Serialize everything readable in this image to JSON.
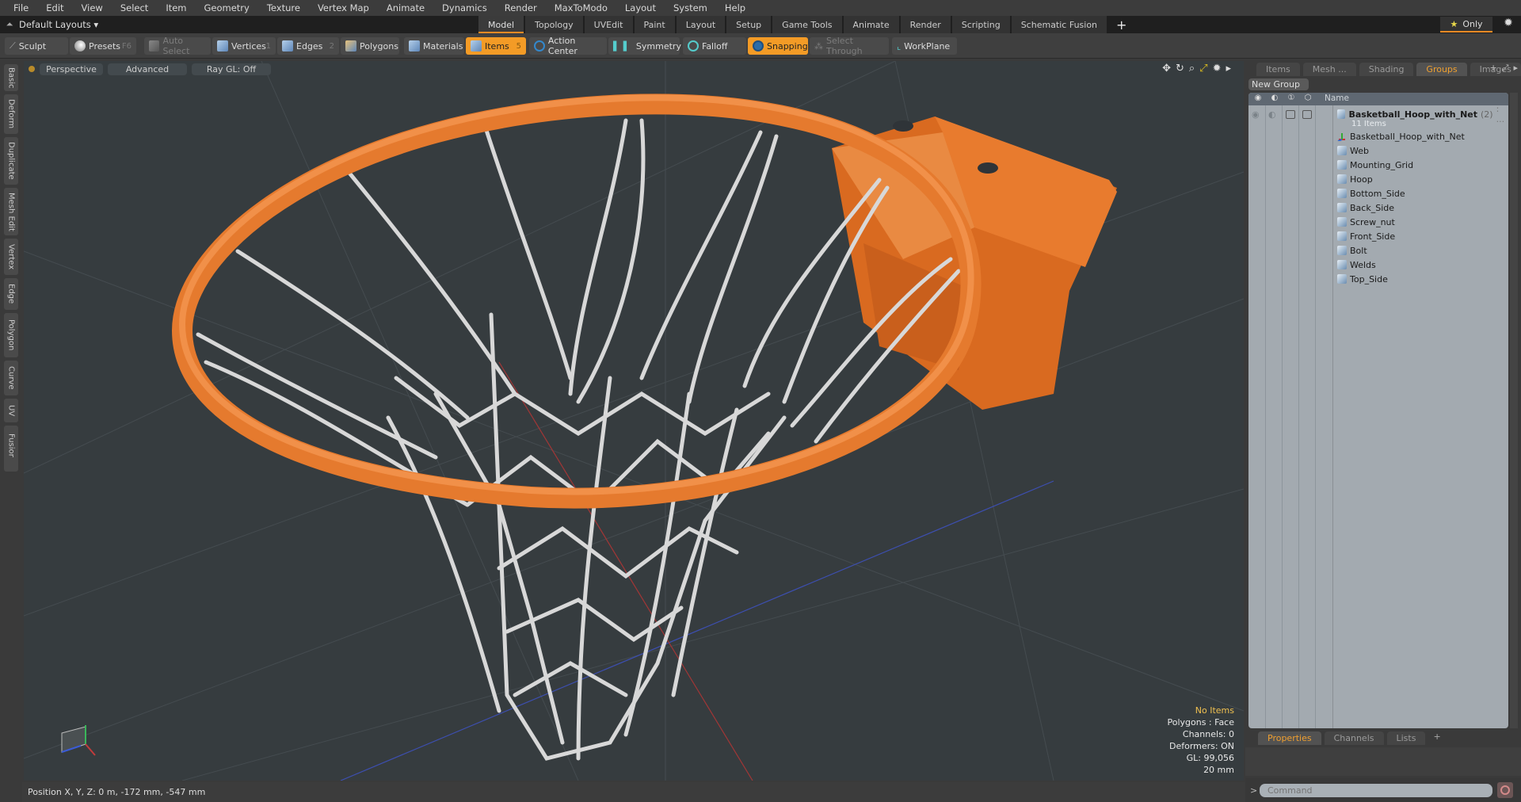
{
  "menu": [
    "File",
    "Edit",
    "View",
    "Select",
    "Item",
    "Geometry",
    "Texture",
    "Vertex Map",
    "Animate",
    "Dynamics",
    "Render",
    "MaxToModo",
    "Layout",
    "System",
    "Help"
  ],
  "layout_bar": {
    "layout_name": "Default Layouts ▾",
    "tabs": [
      "Model",
      "Topology",
      "UVEdit",
      "Paint",
      "Layout",
      "Setup",
      "Game Tools",
      "Animate",
      "Render",
      "Scripting",
      "Schematic Fusion"
    ],
    "active_tab": "Model",
    "only_label": "Only"
  },
  "toolbar": {
    "sculpt": "Sculpt",
    "presets": "Presets",
    "presets_hotkey": "F6",
    "auto_select": "Auto Select",
    "vertices": "Vertices",
    "vertices_hotkey": "1",
    "edges": "Edges",
    "edges_hotkey": "2",
    "polygons": "Polygons",
    "materials": "Materials",
    "items": "Items",
    "items_hotkey": "5",
    "action_center": "Action Center",
    "symmetry": "Symmetry",
    "falloff": "Falloff",
    "snapping": "Snapping",
    "select_through": "Select Through",
    "workplane": "WorkPlane",
    "accent_color": "#f39b26"
  },
  "left_tabs": [
    "Basic",
    "Deform",
    "Duplicate",
    "Mesh Edit",
    "Vertex",
    "Edge",
    "Polygon",
    "Curve",
    "UV",
    "Fusion"
  ],
  "viewport": {
    "view": "Perspective",
    "shading": "Advanced",
    "raygl": "Ray GL: Off",
    "info": {
      "selection": "No Items",
      "polygons": "Polygons : Face",
      "channels": "Channels: 0",
      "deformers": "Deformers: ON",
      "gl": "GL: 99,056",
      "unit": "20 mm"
    }
  },
  "status": {
    "position": "Position X, Y, Z:   0 m, -172 mm, -547 mm"
  },
  "right_panel": {
    "tabs": [
      "Items",
      "Mesh ...",
      "Shading",
      "Groups",
      "Images"
    ],
    "active_tab": "Groups",
    "new_group": "New Group",
    "column_name": "Name",
    "group": {
      "name": "Basketball_Hoop_with_Net",
      "count": "(2)",
      "suffix": ": ...",
      "items_count": "11 Items",
      "children": [
        {
          "name": "Basketball_Hoop_with_Net",
          "type": "locator"
        },
        {
          "name": "Web",
          "type": "mesh"
        },
        {
          "name": "Mounting_Grid",
          "type": "mesh"
        },
        {
          "name": "Hoop",
          "type": "mesh"
        },
        {
          "name": "Bottom_Side",
          "type": "mesh"
        },
        {
          "name": "Back_Side",
          "type": "mesh"
        },
        {
          "name": "Screw_nut",
          "type": "mesh"
        },
        {
          "name": "Front_Side",
          "type": "mesh"
        },
        {
          "name": "Bolt",
          "type": "mesh"
        },
        {
          "name": "Welds",
          "type": "mesh"
        },
        {
          "name": "Top_Side",
          "type": "mesh"
        }
      ]
    },
    "bottom_tabs": [
      "Properties",
      "Channels",
      "Lists"
    ],
    "bottom_active": "Properties",
    "command_placeholder": "Command"
  }
}
